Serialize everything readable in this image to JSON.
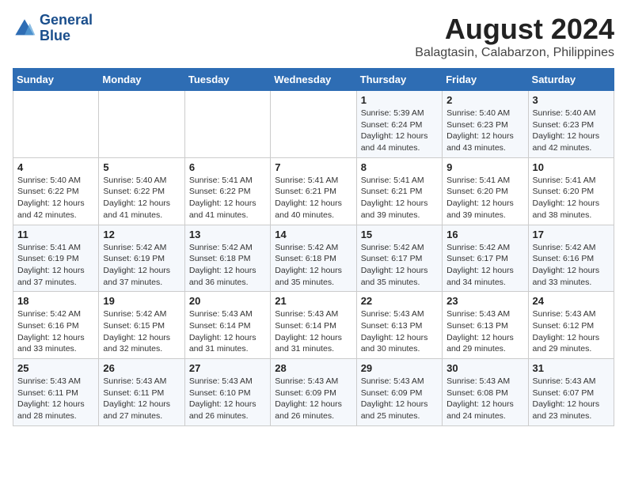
{
  "header": {
    "logo_line1": "General",
    "logo_line2": "Blue",
    "title": "August 2024",
    "subtitle": "Balagtasin, Calabarzon, Philippines"
  },
  "columns": [
    "Sunday",
    "Monday",
    "Tuesday",
    "Wednesday",
    "Thursday",
    "Friday",
    "Saturday"
  ],
  "weeks": [
    [
      {
        "num": "",
        "info": ""
      },
      {
        "num": "",
        "info": ""
      },
      {
        "num": "",
        "info": ""
      },
      {
        "num": "",
        "info": ""
      },
      {
        "num": "1",
        "info": "Sunrise: 5:39 AM\nSunset: 6:24 PM\nDaylight: 12 hours\nand 44 minutes."
      },
      {
        "num": "2",
        "info": "Sunrise: 5:40 AM\nSunset: 6:23 PM\nDaylight: 12 hours\nand 43 minutes."
      },
      {
        "num": "3",
        "info": "Sunrise: 5:40 AM\nSunset: 6:23 PM\nDaylight: 12 hours\nand 42 minutes."
      }
    ],
    [
      {
        "num": "4",
        "info": "Sunrise: 5:40 AM\nSunset: 6:22 PM\nDaylight: 12 hours\nand 42 minutes."
      },
      {
        "num": "5",
        "info": "Sunrise: 5:40 AM\nSunset: 6:22 PM\nDaylight: 12 hours\nand 41 minutes."
      },
      {
        "num": "6",
        "info": "Sunrise: 5:41 AM\nSunset: 6:22 PM\nDaylight: 12 hours\nand 41 minutes."
      },
      {
        "num": "7",
        "info": "Sunrise: 5:41 AM\nSunset: 6:21 PM\nDaylight: 12 hours\nand 40 minutes."
      },
      {
        "num": "8",
        "info": "Sunrise: 5:41 AM\nSunset: 6:21 PM\nDaylight: 12 hours\nand 39 minutes."
      },
      {
        "num": "9",
        "info": "Sunrise: 5:41 AM\nSunset: 6:20 PM\nDaylight: 12 hours\nand 39 minutes."
      },
      {
        "num": "10",
        "info": "Sunrise: 5:41 AM\nSunset: 6:20 PM\nDaylight: 12 hours\nand 38 minutes."
      }
    ],
    [
      {
        "num": "11",
        "info": "Sunrise: 5:41 AM\nSunset: 6:19 PM\nDaylight: 12 hours\nand 37 minutes."
      },
      {
        "num": "12",
        "info": "Sunrise: 5:42 AM\nSunset: 6:19 PM\nDaylight: 12 hours\nand 37 minutes."
      },
      {
        "num": "13",
        "info": "Sunrise: 5:42 AM\nSunset: 6:18 PM\nDaylight: 12 hours\nand 36 minutes."
      },
      {
        "num": "14",
        "info": "Sunrise: 5:42 AM\nSunset: 6:18 PM\nDaylight: 12 hours\nand 35 minutes."
      },
      {
        "num": "15",
        "info": "Sunrise: 5:42 AM\nSunset: 6:17 PM\nDaylight: 12 hours\nand 35 minutes."
      },
      {
        "num": "16",
        "info": "Sunrise: 5:42 AM\nSunset: 6:17 PM\nDaylight: 12 hours\nand 34 minutes."
      },
      {
        "num": "17",
        "info": "Sunrise: 5:42 AM\nSunset: 6:16 PM\nDaylight: 12 hours\nand 33 minutes."
      }
    ],
    [
      {
        "num": "18",
        "info": "Sunrise: 5:42 AM\nSunset: 6:16 PM\nDaylight: 12 hours\nand 33 minutes."
      },
      {
        "num": "19",
        "info": "Sunrise: 5:42 AM\nSunset: 6:15 PM\nDaylight: 12 hours\nand 32 minutes."
      },
      {
        "num": "20",
        "info": "Sunrise: 5:43 AM\nSunset: 6:14 PM\nDaylight: 12 hours\nand 31 minutes."
      },
      {
        "num": "21",
        "info": "Sunrise: 5:43 AM\nSunset: 6:14 PM\nDaylight: 12 hours\nand 31 minutes."
      },
      {
        "num": "22",
        "info": "Sunrise: 5:43 AM\nSunset: 6:13 PM\nDaylight: 12 hours\nand 30 minutes."
      },
      {
        "num": "23",
        "info": "Sunrise: 5:43 AM\nSunset: 6:13 PM\nDaylight: 12 hours\nand 29 minutes."
      },
      {
        "num": "24",
        "info": "Sunrise: 5:43 AM\nSunset: 6:12 PM\nDaylight: 12 hours\nand 29 minutes."
      }
    ],
    [
      {
        "num": "25",
        "info": "Sunrise: 5:43 AM\nSunset: 6:11 PM\nDaylight: 12 hours\nand 28 minutes."
      },
      {
        "num": "26",
        "info": "Sunrise: 5:43 AM\nSunset: 6:11 PM\nDaylight: 12 hours\nand 27 minutes."
      },
      {
        "num": "27",
        "info": "Sunrise: 5:43 AM\nSunset: 6:10 PM\nDaylight: 12 hours\nand 26 minutes."
      },
      {
        "num": "28",
        "info": "Sunrise: 5:43 AM\nSunset: 6:09 PM\nDaylight: 12 hours\nand 26 minutes."
      },
      {
        "num": "29",
        "info": "Sunrise: 5:43 AM\nSunset: 6:09 PM\nDaylight: 12 hours\nand 25 minutes."
      },
      {
        "num": "30",
        "info": "Sunrise: 5:43 AM\nSunset: 6:08 PM\nDaylight: 12 hours\nand 24 minutes."
      },
      {
        "num": "31",
        "info": "Sunrise: 5:43 AM\nSunset: 6:07 PM\nDaylight: 12 hours\nand 23 minutes."
      }
    ]
  ]
}
